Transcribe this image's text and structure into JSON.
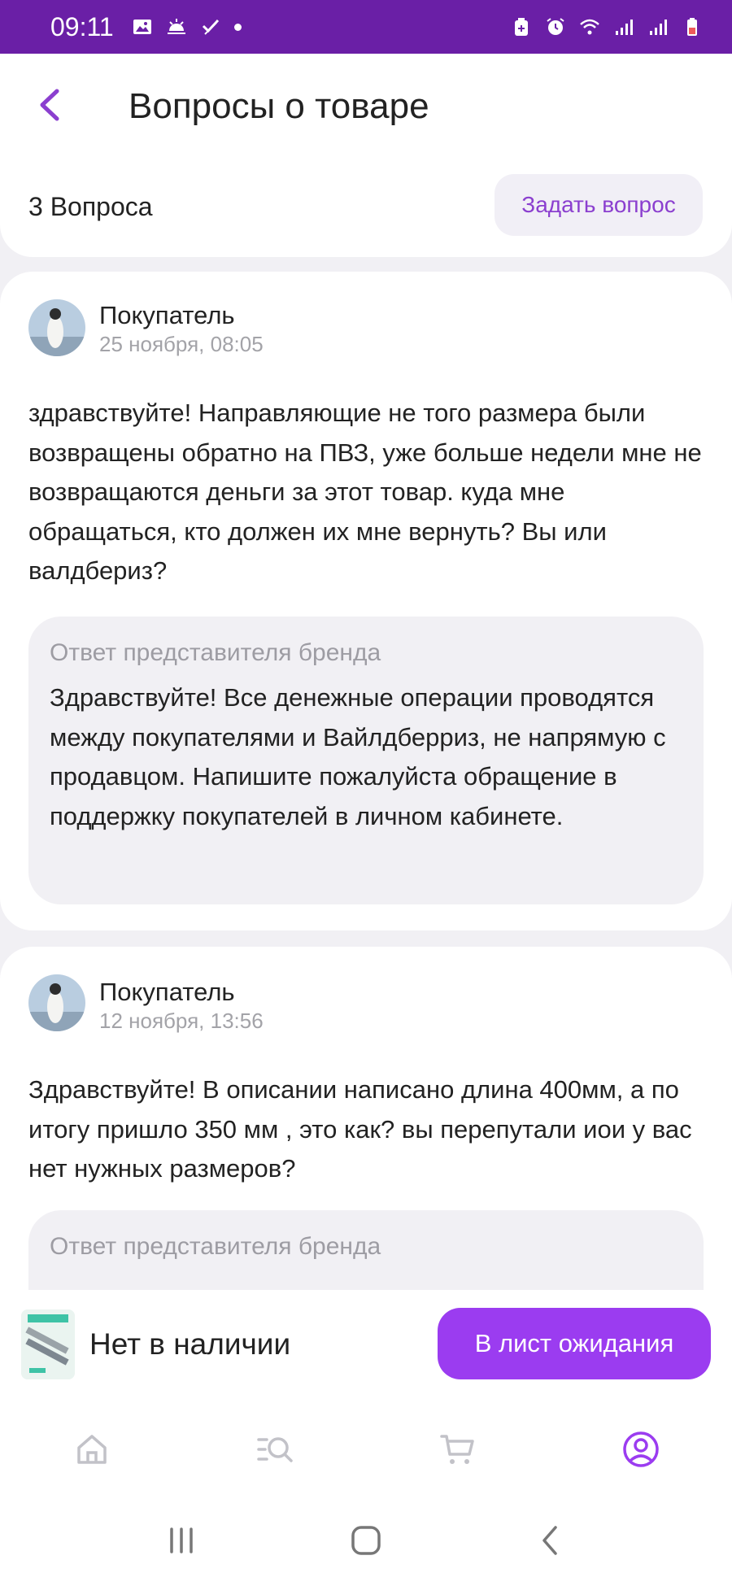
{
  "status_bar": {
    "time": "09:11",
    "left_icons": [
      "gallery-icon",
      "weather-icon",
      "tools-icon",
      "notification-dot"
    ],
    "right_icons": [
      "battery-saver-icon",
      "alarm-icon",
      "wifi-icon",
      "signal-icon",
      "signal-r-icon",
      "battery-icon"
    ]
  },
  "header": {
    "title": "Вопросы о товаре",
    "count": "3 Вопроса",
    "ask_button": "Задать вопрос"
  },
  "questions": [
    {
      "author": "Покупатель",
      "date": "25 ноября, 08:05",
      "text": "здравствуйте! Направляющие не того размера были возвращены обратно на ПВЗ, уже больше недели мне не возвращаются деньги за этот товар. куда мне обращаться,  кто должен их мне вернуть? Вы или валдбериз?",
      "answer_label": "Ответ представителя бренда",
      "answer_text": "Здравствуйте! Все денежные операции проводятся между покупателями и Вайлдберриз, не напрямую с продавцом. Напишите пожалуйста обращение в поддержку покупателей в личном кабинете."
    },
    {
      "author": "Покупатель",
      "date": "12 ноября, 13:56",
      "text": "Здравствуйте! В описании написано длина 400мм, а по итогу пришло 350 мм , это как? вы перепутали иои у вас нет нужных размеров?",
      "answer_label": "Ответ представителя бренда",
      "answer_text": ""
    }
  ],
  "product_bar": {
    "stock_status": "Нет в наличии",
    "waitlist_button": "В лист ожидания"
  },
  "bottom_nav": {
    "items": [
      "home-icon",
      "catalog-search-icon",
      "cart-icon",
      "profile-icon"
    ],
    "active": "profile-icon"
  },
  "system_nav": [
    "recent-apps-icon",
    "home-button-icon",
    "back-nav-icon"
  ],
  "colors": {
    "status_bar": "#6a1fa6",
    "accent": "#9b3cf0",
    "accent_text": "#8b3fcf",
    "background": "#f1f0f4",
    "muted_text": "#a3a3a8"
  }
}
